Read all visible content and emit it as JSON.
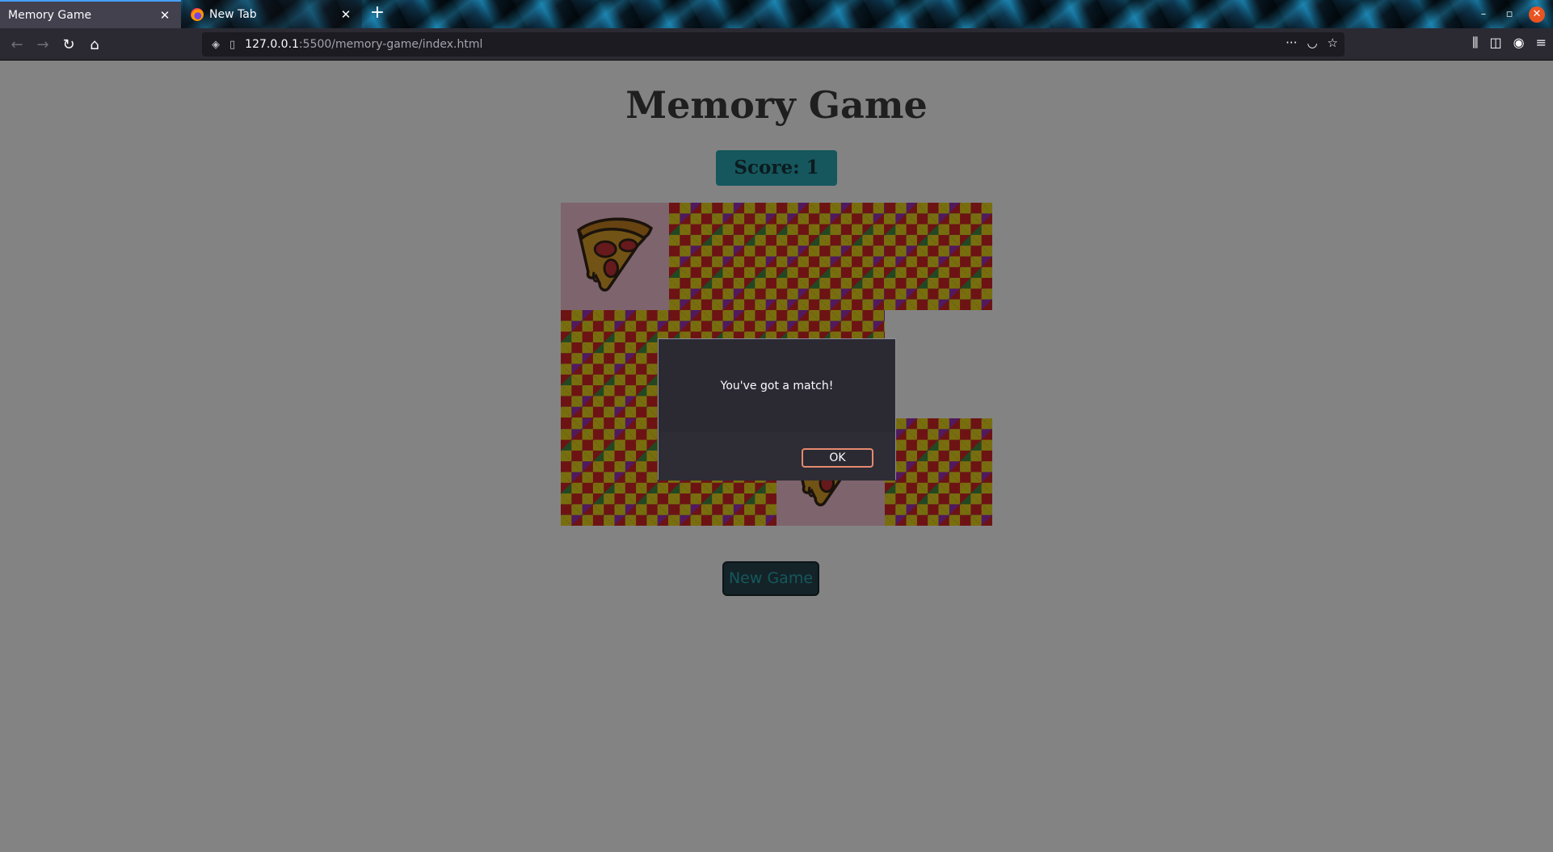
{
  "browser": {
    "tabs": [
      {
        "label": "Memory Game",
        "active": true
      },
      {
        "label": "New Tab",
        "active": false
      }
    ],
    "url_host": "127.0.0.1",
    "url_path": ":5500/memory-game/index.html"
  },
  "page": {
    "title": "Memory Game",
    "score_text": "Score: 1",
    "new_game_label": "New Game",
    "cards": [
      {
        "state": "face",
        "image": "pizza"
      },
      {
        "state": "back"
      },
      {
        "state": "back"
      },
      {
        "state": "back"
      },
      {
        "state": "back"
      },
      {
        "state": "back"
      },
      {
        "state": "back"
      },
      {
        "state": "empty"
      },
      {
        "state": "back"
      },
      {
        "state": "back"
      },
      {
        "state": "face",
        "image": "pizza"
      },
      {
        "state": "back"
      }
    ]
  },
  "dialog": {
    "message": "You've got a match!",
    "ok_label": "OK"
  },
  "colors": {
    "accent": "#1fa3ad",
    "card_face_bg": "#f0bccd",
    "dialog_ok_border": "#e68a6f"
  }
}
